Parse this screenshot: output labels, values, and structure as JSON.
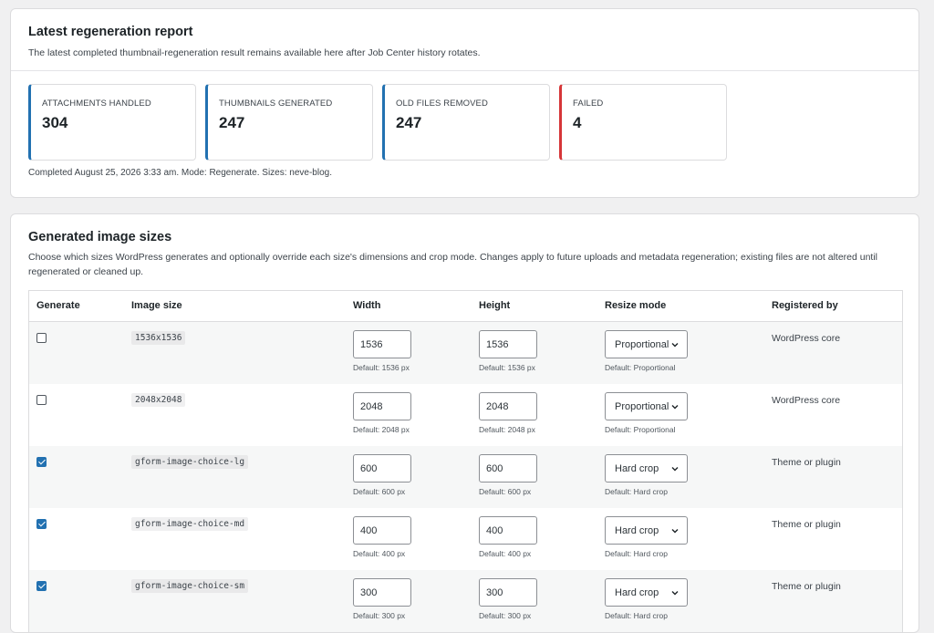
{
  "report": {
    "title": "Latest regeneration report",
    "description": "The latest completed thumbnail-regeneration result remains available here after Job Center history rotates.",
    "stats": [
      {
        "label": "ATTACHMENTS HANDLED",
        "value": "304",
        "accent": "#2271b1"
      },
      {
        "label": "THUMBNAILS GENERATED",
        "value": "247",
        "accent": "#2271b1"
      },
      {
        "label": "OLD FILES REMOVED",
        "value": "247",
        "accent": "#2271b1"
      },
      {
        "label": "FAILED",
        "value": "4",
        "accent": "#d63638"
      }
    ],
    "footer": "Completed August 25, 2026 3:33 am. Mode: Regenerate. Sizes: neve-blog."
  },
  "sizes": {
    "title": "Generated image sizes",
    "description": "Choose which sizes WordPress generates and optionally override each size's dimensions and crop mode. Changes apply to future uploads and metadata regeneration; existing files are not altered until regenerated or cleaned up.",
    "columns": {
      "generate": "Generate",
      "image_size": "Image size",
      "width": "Width",
      "height": "Height",
      "resize_mode": "Resize mode",
      "registered_by": "Registered by"
    },
    "rows": [
      {
        "checked": false,
        "name": "1536x1536",
        "width": "1536",
        "width_default": "Default: 1536 px",
        "height": "1536",
        "height_default": "Default: 1536 px",
        "mode": "Proportional",
        "mode_default": "Default: Proportional",
        "registered_by": "WordPress core"
      },
      {
        "checked": false,
        "name": "2048x2048",
        "width": "2048",
        "width_default": "Default: 2048 px",
        "height": "2048",
        "height_default": "Default: 2048 px",
        "mode": "Proportional",
        "mode_default": "Default: Proportional",
        "registered_by": "WordPress core"
      },
      {
        "checked": true,
        "name": "gform-image-choice-lg",
        "width": "600",
        "width_default": "Default: 600 px",
        "height": "600",
        "height_default": "Default: 600 px",
        "mode": "Hard crop",
        "mode_default": "Default: Hard crop",
        "registered_by": "Theme or plugin"
      },
      {
        "checked": true,
        "name": "gform-image-choice-md",
        "width": "400",
        "width_default": "Default: 400 px",
        "height": "400",
        "height_default": "Default: 400 px",
        "mode": "Hard crop",
        "mode_default": "Default: Hard crop",
        "registered_by": "Theme or plugin"
      },
      {
        "checked": true,
        "name": "gform-image-choice-sm",
        "width": "300",
        "width_default": "Default: 300 px",
        "height": "300",
        "height_default": "Default: 300 px",
        "mode": "Hard crop",
        "mode_default": "Default: Hard crop",
        "registered_by": "Theme or plugin"
      }
    ]
  }
}
